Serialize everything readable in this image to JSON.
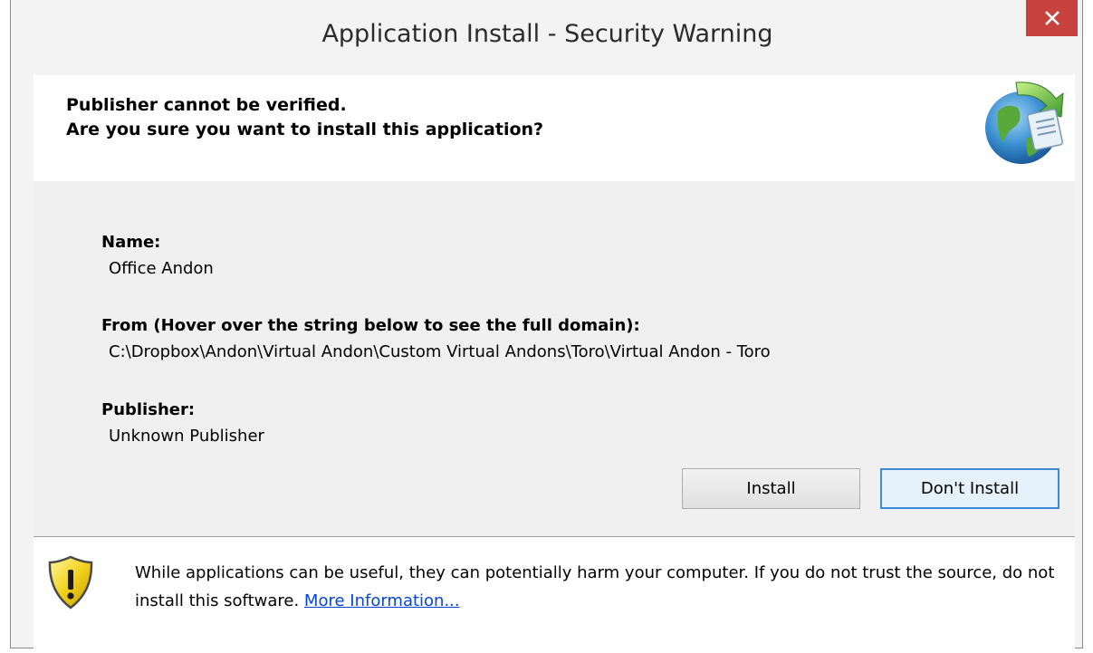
{
  "window": {
    "title": "Application Install - Security Warning",
    "close_icon": "close-icon",
    "close_color": "#c7413d"
  },
  "header": {
    "line1": "Publisher cannot be verified.",
    "line2": "Are you sure you want to install this application?",
    "icon": "globe-install-icon"
  },
  "details": {
    "name_label": "Name:",
    "name_value": "Office Andon",
    "from_label": "From (Hover over the string below to see the full domain):",
    "from_value": "C:\\Dropbox\\Andon\\Virtual Andon\\Custom Virtual Andons\\Toro\\Virtual Andon - Toro",
    "publisher_label": "Publisher:",
    "publisher_value": "Unknown Publisher"
  },
  "buttons": {
    "install_label": "Install",
    "dont_install_label": "Don't Install"
  },
  "footer": {
    "icon": "warning-shield-icon",
    "text": "While applications can be useful, they can potentially harm your computer. If you do not trust the source, do not install this software. ",
    "link_label": "More Information...",
    "link_color": "#0645d6"
  }
}
